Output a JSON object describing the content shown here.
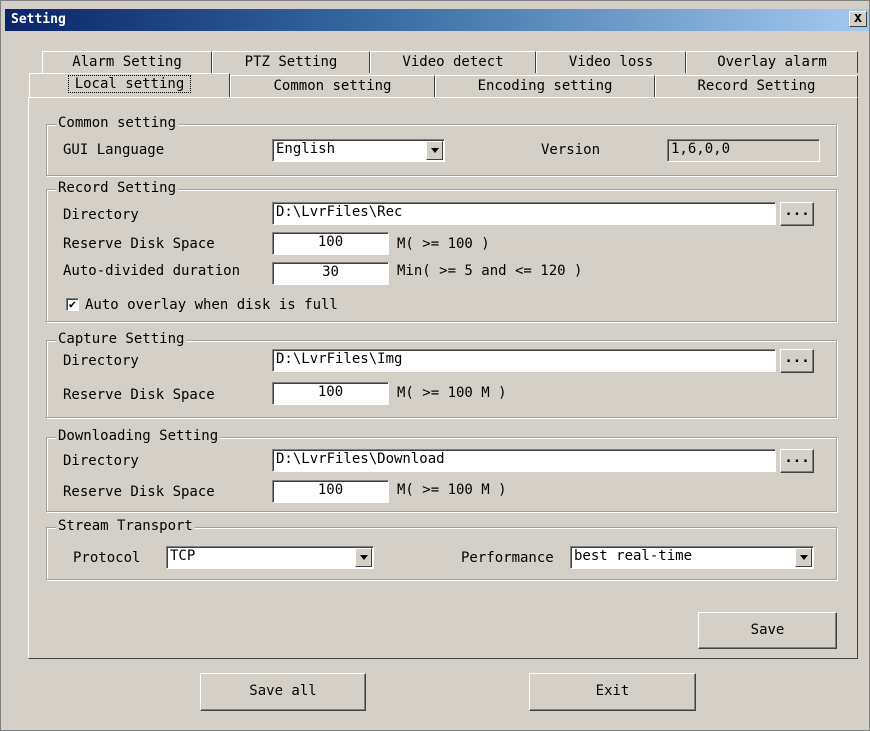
{
  "window": {
    "title": "Setting",
    "close": "x"
  },
  "tabs_row1": [
    "Alarm Setting",
    "PTZ Setting",
    "Video detect",
    "Video loss",
    "Overlay alarm"
  ],
  "tabs_row2": [
    "Local setting",
    "Common setting",
    "Encoding setting",
    "Record Setting"
  ],
  "active_tab": "Local setting",
  "common": {
    "title": "Common setting",
    "gui_language_label": "GUI Language",
    "gui_language_value": "English",
    "version_label": "Version",
    "version_value": "1,6,0,0"
  },
  "record": {
    "title": "Record Setting",
    "directory_label": "Directory",
    "directory_value": "D:\\LvrFiles\\Rec",
    "reserve_label": "Reserve Disk Space",
    "reserve_value": "100",
    "reserve_hint": "M( >= 100 )",
    "autodiv_label": "Auto-divided duration",
    "autodiv_value": "30",
    "autodiv_hint": "Min( >= 5 and <= 120 )",
    "overlay_label": "Auto overlay when disk is full",
    "overlay_checked": true,
    "browse": "..."
  },
  "capture": {
    "title": "Capture Setting",
    "directory_label": "Directory",
    "directory_value": "D:\\LvrFiles\\Img",
    "reserve_label": "Reserve Disk Space",
    "reserve_value": "100",
    "reserve_hint": "M( >= 100 M )",
    "browse": "..."
  },
  "downloading": {
    "title": "Downloading Setting",
    "directory_label": "Directory",
    "directory_value": "D:\\LvrFiles\\Download",
    "reserve_label": "Reserve Disk Space",
    "reserve_value": "100",
    "reserve_hint": "M( >= 100 M )",
    "browse": "..."
  },
  "stream": {
    "title": "Stream Transport",
    "protocol_label": "Protocol",
    "protocol_value": "TCP",
    "performance_label": "Performance",
    "performance_value": "best real-time"
  },
  "buttons": {
    "save": "Save",
    "save_all": "Save all",
    "exit": "Exit"
  }
}
